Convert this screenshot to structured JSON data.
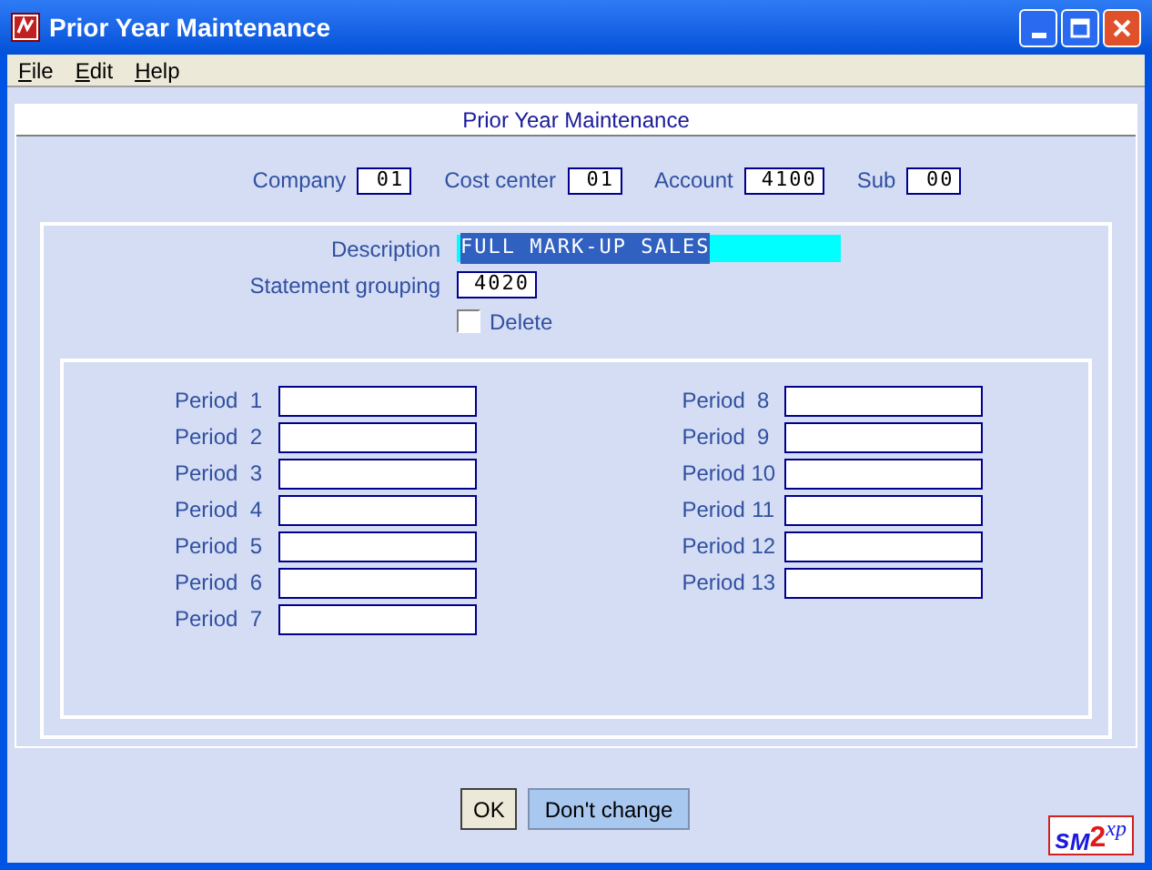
{
  "window": {
    "title": "Prior Year Maintenance"
  },
  "menu": [
    {
      "label": "File"
    },
    {
      "label": "Edit"
    },
    {
      "label": "Help"
    }
  ],
  "form_title": "Prior Year Maintenance",
  "keys": [
    {
      "label": "Company",
      "value": "01"
    },
    {
      "label": "Cost center",
      "value": "01"
    },
    {
      "label": "Account",
      "value": "4100"
    },
    {
      "label": "Sub",
      "value": "00"
    }
  ],
  "description": {
    "label": "Description",
    "value": "FULL MARK-UP SALES",
    "selected": true
  },
  "statement_grouping": {
    "label": "Statement grouping",
    "value": "4020"
  },
  "delete": {
    "label": "Delete",
    "checked": false
  },
  "periods": [
    {
      "label": "Period",
      "number": "1"
    },
    {
      "label": "Period",
      "number": "2"
    },
    {
      "label": "Period",
      "number": "3"
    },
    {
      "label": "Period",
      "number": "4"
    },
    {
      "label": "Period",
      "number": "5"
    },
    {
      "label": "Period",
      "number": "6"
    },
    {
      "label": "Period",
      "number": "7"
    },
    {
      "label": "Period",
      "number": "8"
    },
    {
      "label": "Period",
      "number": "9"
    },
    {
      "label": "Period",
      "number": "10"
    },
    {
      "label": "Period",
      "number": "11"
    },
    {
      "label": "Period",
      "number": "12"
    },
    {
      "label": "Period",
      "number": "13"
    }
  ],
  "buttons": [
    {
      "label": "OK",
      "kind": "default"
    },
    {
      "label": "Don't change",
      "kind": "highlighted"
    }
  ],
  "logo": [
    "s",
    "M",
    "2",
    "xp"
  ]
}
